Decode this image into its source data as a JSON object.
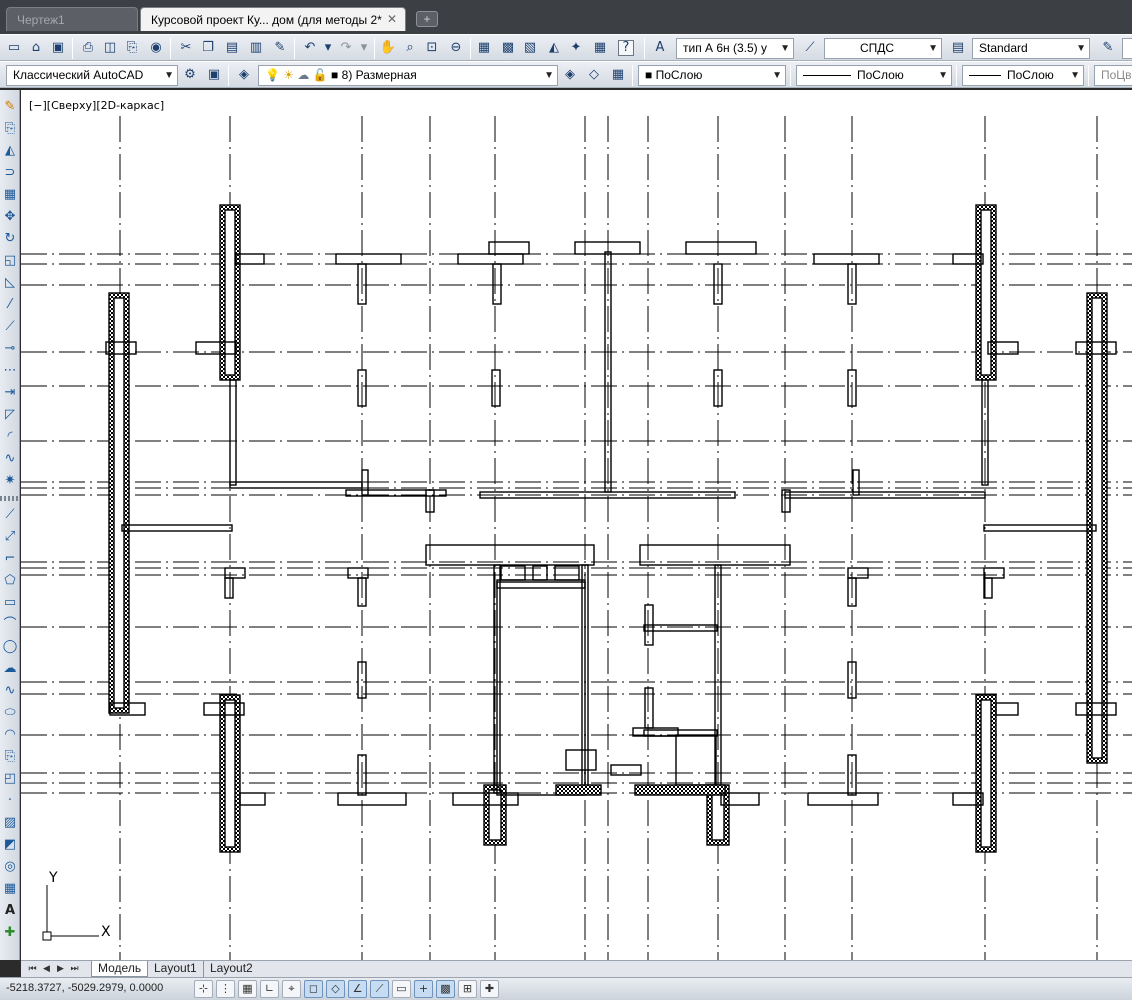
{
  "tabs": [
    {
      "label": "Чертеж1",
      "active": false
    },
    {
      "label": "Курсовой проект Ку... дом (для методы 2*",
      "active": true
    }
  ],
  "tab_close_glyph": "✕",
  "new_tab_glyph": "+",
  "toolbar1": {
    "text_style": "тип А 6н (3.5) у",
    "dim_style": "СПДС",
    "table_style": "Standard"
  },
  "toolbar2": {
    "workspace": "Классический AutoCAD",
    "layer": "8) Размерная",
    "color": "ПоСлою",
    "linetype": "ПоСлою",
    "lineweight": "ПоСлою",
    "plotstyle": "ПоЦве"
  },
  "canvas": {
    "view_label": "[−][Сверху][2D-каркас]",
    "ucs_y": "Y",
    "ucs_x": "X"
  },
  "layout_tabs": [
    "Модель",
    "Layout1",
    "Layout2"
  ],
  "status": {
    "coordinates": "-5218.3727, -5029.2979, 0.0000"
  },
  "colors": {
    "tab_bar": "#3c3f44",
    "canvas": "#ffffff",
    "toolbar": "#dde3ea",
    "icon_accent": "#1d5a99"
  }
}
